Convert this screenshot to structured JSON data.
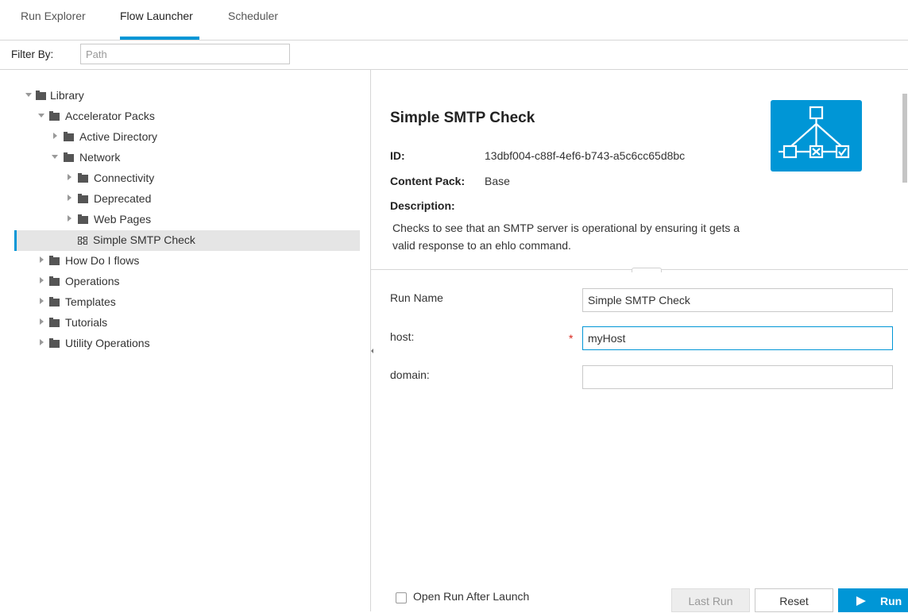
{
  "tabs": [
    {
      "label": "Run Explorer"
    },
    {
      "label": "Flow Launcher"
    },
    {
      "label": "Scheduler"
    }
  ],
  "active_tab": "Flow Launcher",
  "accent_color": "#0096d6",
  "filter": {
    "label": "Filter By:",
    "placeholder": "Path"
  },
  "tree": {
    "library": "Library",
    "accelerator_packs": "Accelerator Packs",
    "active_directory": "Active Directory",
    "network": "Network",
    "connectivity": "Connectivity",
    "deprecated": "Deprecated",
    "web_pages": "Web Pages",
    "simple_smtp_check": "Simple SMTP Check",
    "how_do_i_flows": "How Do I flows",
    "operations": "Operations",
    "templates": "Templates",
    "tutorials": "Tutorials",
    "utility_operations": "Utility Operations"
  },
  "details": {
    "title": "Simple SMTP Check",
    "id_label": "ID:",
    "id_value": "13dbf004-c88f-4ef6-b743-a5c6cc65d8bc",
    "content_pack_label": "Content Pack:",
    "content_pack_value": "Base",
    "description_label": "Description:",
    "description_text": "Checks to see that an SMTP server is operational by ensuring it gets a valid response to an ehlo command.",
    "icon": "flow-diagram-icon"
  },
  "form": {
    "run_name_label": "Run Name",
    "run_name_value": "Simple SMTP Check",
    "host_label": "host:",
    "host_required": "*",
    "host_value": "myHost",
    "domain_label": "domain:",
    "domain_value": ""
  },
  "footer": {
    "open_run_label": "Open Run After Launch",
    "last_run": "Last Run",
    "reset": "Reset",
    "run": "Run"
  }
}
